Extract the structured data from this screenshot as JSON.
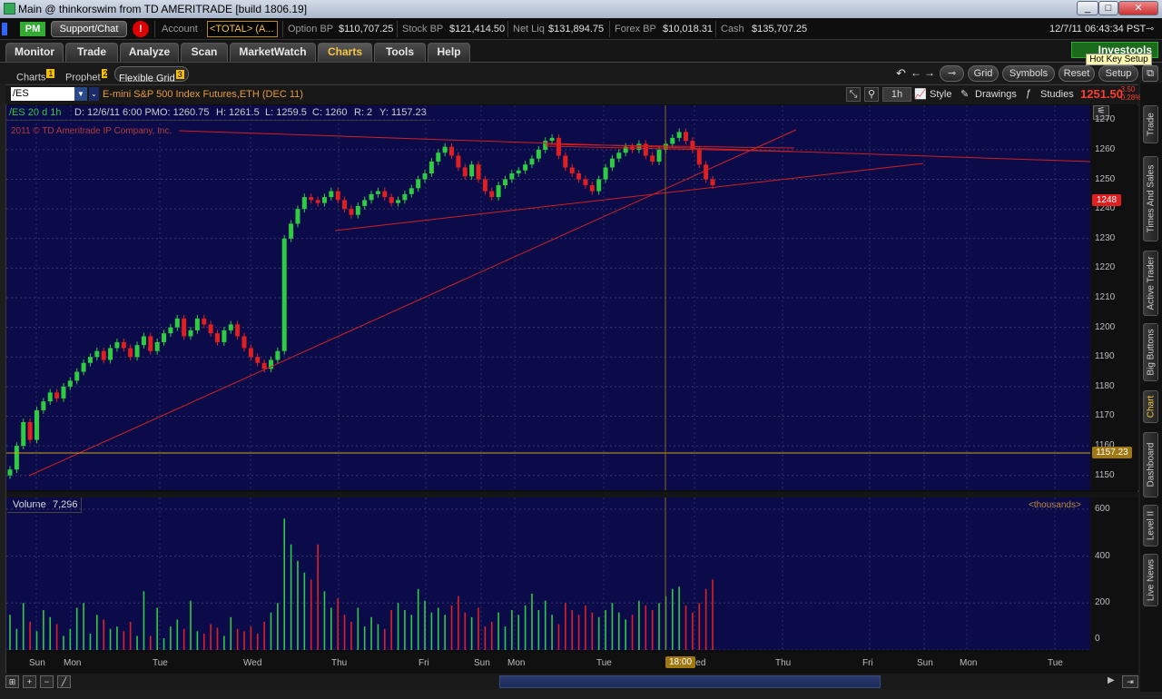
{
  "window": {
    "title": "Main @ thinkorswim from TD AMERITRADE [build 1806.19]",
    "buttons": {
      "minimize": "_",
      "maximize": "□",
      "close": "✕"
    }
  },
  "account_bar": {
    "pm_badge": "PM",
    "support_button": "Support/Chat",
    "alert_icon": "!",
    "account_label": "Account",
    "account_value": "<TOTAL> (A...",
    "option_bp_label": "Option BP",
    "option_bp": "$110,707.25",
    "stock_bp_label": "Stock BP",
    "stock_bp": "$121,414.50",
    "net_liq_label": "Net Liq",
    "net_liq": "$131,894.75",
    "forex_bp_label": "Forex BP",
    "forex_bp": "$10,018.31",
    "cash_label": "Cash",
    "cash": "$135,707.25",
    "datetime": "12/7/11 06:43:34 PST"
  },
  "nav_tabs": [
    "Monitor",
    "Trade",
    "Analyze",
    "Scan",
    "MarketWatch",
    "Charts",
    "Tools",
    "Help"
  ],
  "investools": {
    "label": "Investools",
    "tooltip": "Hot Key Setup"
  },
  "sub_tabs": [
    {
      "label": "Charts",
      "badge": "1"
    },
    {
      "label": "Prophet",
      "badge": "2"
    },
    {
      "label": "Flexible Grid",
      "badge": "3"
    }
  ],
  "sub_buttons": {
    "grid": "Grid",
    "symbols": "Symbols",
    "reset": "Reset",
    "setup": "Setup"
  },
  "symbol": {
    "ticker": "/ES",
    "description": "E-mini S&P 500 Index Futures,ETH (DEC 11)",
    "price": "1251.50",
    "change": "-3.50",
    "change_pct": "-0.28%"
  },
  "toolbar": {
    "interval": "1h",
    "style": "Style",
    "drawings": "Drawings",
    "studies": "Studies"
  },
  "ohlc": {
    "sym": "/ES 20 d 1h",
    "date": "D: 12/6/11 6:00 PM",
    "open": "O: 1260.75",
    "high": "H: 1261.5",
    "low": "L: 1259.5",
    "close": "C: 1260",
    "range": "R: 2",
    "y": "Y: 1157.23"
  },
  "watermark": "2011 © TD Ameritrade IP Company, Inc.",
  "price_axis": {
    "ticks": [
      "1270",
      "1260",
      "1250",
      "1240",
      "1230",
      "1220",
      "1210",
      "1200",
      "1190",
      "1180",
      "1170",
      "1160",
      "1150"
    ],
    "last_marker": "1248",
    "cursor_marker": "1157.23"
  },
  "volume": {
    "label": "Volume",
    "value": "7,296",
    "units": "<thousands>",
    "ticks": [
      "600",
      "400",
      "200",
      "0"
    ]
  },
  "x_axis": {
    "labels": [
      "Sun",
      "Mon",
      "Tue",
      "Wed",
      "Thu",
      "Fri",
      "Sun",
      "Mon",
      "Tue",
      "Wed",
      "Thu",
      "Fri",
      "Sun",
      "Mon",
      "Tue"
    ],
    "cursor_time": "18:00"
  },
  "right_tabs": [
    "Trade",
    "Times And Sales",
    "Active Trader",
    "Big Buttons",
    "Chart",
    "Dashboard",
    "Level II",
    "Live News"
  ],
  "colors": {
    "accent": "#f7c640",
    "plot": "#0b0b4a",
    "up": "#2ecc40",
    "down": "#e02020",
    "trend": "#d02020"
  },
  "chart_data": {
    "type": "candlestick",
    "ylim": [
      1145,
      1275
    ],
    "closes": [
      1152,
      1160,
      1168,
      1162,
      1172,
      1175,
      1178,
      1176,
      1180,
      1182,
      1185,
      1188,
      1190,
      1192,
      1189,
      1193,
      1195,
      1193,
      1190,
      1194,
      1197,
      1192,
      1195,
      1198,
      1200,
      1203,
      1197,
      1199,
      1203,
      1201,
      1198,
      1195,
      1199,
      1201,
      1197,
      1193,
      1190,
      1188,
      1186,
      1189,
      1192,
      1230,
      1235,
      1240,
      1244,
      1243,
      1242,
      1244,
      1246,
      1243,
      1240,
      1238,
      1241,
      1243,
      1245,
      1246,
      1244,
      1242,
      1243,
      1245,
      1247,
      1250,
      1252,
      1256,
      1259,
      1261,
      1258,
      1254,
      1251,
      1255,
      1250,
      1246,
      1244,
      1248,
      1250,
      1252,
      1253,
      1255,
      1257,
      1260,
      1263,
      1264,
      1258,
      1254,
      1252,
      1250,
      1248,
      1246,
      1250,
      1254,
      1257,
      1259,
      1261,
      1260,
      1262,
      1258,
      1256,
      1260,
      1262,
      1264,
      1266,
      1263,
      1260,
      1255,
      1250,
      1248
    ],
    "volumes": [
      150,
      90,
      200,
      120,
      80,
      170,
      140,
      110,
      60,
      90,
      180,
      200,
      70,
      150,
      130,
      90,
      100,
      80,
      120,
      60,
      250,
      60,
      180,
      50,
      100,
      130,
      90,
      210,
      80,
      70,
      110,
      95,
      60,
      140,
      90,
      80,
      100,
      70,
      120,
      160,
      200,
      560,
      450,
      380,
      330,
      300,
      450,
      250,
      180,
      220,
      150,
      120,
      180,
      100,
      140,
      110,
      90,
      170,
      200,
      170,
      150,
      260,
      210,
      160,
      180,
      150,
      190,
      230,
      160,
      140,
      180,
      100,
      120,
      160,
      100,
      170,
      150,
      190,
      240,
      170,
      210,
      150,
      110,
      200,
      170,
      150,
      190,
      160,
      140,
      170,
      200,
      160,
      130,
      150,
      210,
      190,
      170,
      200,
      230,
      260,
      270,
      190,
      160,
      200,
      260,
      300
    ],
    "volume_ylim": [
      0,
      650
    ]
  }
}
